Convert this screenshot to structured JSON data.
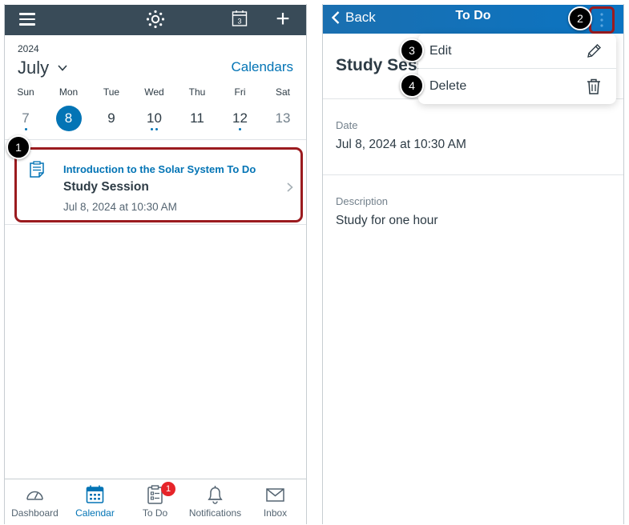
{
  "left": {
    "topbar": {
      "hamburger": "hamburger-icon",
      "logo": "canvas-logo-icon",
      "calendar_today": "3",
      "plus": "+"
    },
    "year": "2024",
    "month": "July",
    "calendars_link": "Calendars",
    "week": [
      {
        "name": "Sun",
        "num": "7",
        "dots": 1,
        "muted": true,
        "selected": false
      },
      {
        "name": "Mon",
        "num": "8",
        "dots": 0,
        "muted": false,
        "selected": true
      },
      {
        "name": "Tue",
        "num": "9",
        "dots": 0,
        "muted": false,
        "selected": false
      },
      {
        "name": "Wed",
        "num": "10",
        "dots": 2,
        "muted": false,
        "selected": false
      },
      {
        "name": "Thu",
        "num": "11",
        "dots": 0,
        "muted": false,
        "selected": false
      },
      {
        "name": "Fri",
        "num": "12",
        "dots": 1,
        "muted": false,
        "selected": false
      },
      {
        "name": "Sat",
        "num": "13",
        "dots": 0,
        "muted": true,
        "selected": false
      }
    ],
    "event": {
      "course": "Introduction to the Solar System To Do",
      "title": "Study Session",
      "date": "Jul 8, 2024 at 10:30 AM"
    },
    "tabs": [
      {
        "label": "Dashboard",
        "icon": "dashboard-icon",
        "active": false
      },
      {
        "label": "Calendar",
        "icon": "calendar-icon",
        "active": true
      },
      {
        "label": "To Do",
        "icon": "todo-icon",
        "active": false,
        "badge": "1"
      },
      {
        "label": "Notifications",
        "icon": "bell-icon",
        "active": false
      },
      {
        "label": "Inbox",
        "icon": "inbox-icon",
        "active": false
      }
    ]
  },
  "right": {
    "back": "Back",
    "title": "To Do",
    "heading": "Study Sess",
    "date_label": "Date",
    "date_value": "Jul 8, 2024 at 10:30 AM",
    "description_label": "Description",
    "description_value": "Study for one hour",
    "menu": [
      {
        "label": "Edit",
        "icon": "pencil-icon"
      },
      {
        "label": "Delete",
        "icon": "trash-icon"
      }
    ]
  },
  "callouts": [
    "1",
    "2",
    "3",
    "4"
  ],
  "colors": {
    "nav_dark": "#394b58",
    "brand_blue": "#0374b5",
    "highlight_red": "#9b1b1f",
    "badge_red": "#e62429"
  }
}
